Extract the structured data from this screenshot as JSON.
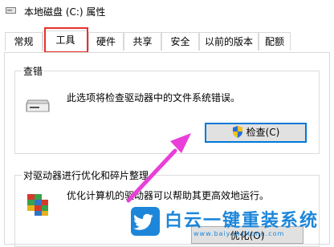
{
  "window": {
    "title": "本地磁盘 (C:) 属性"
  },
  "tabs": [
    {
      "label": "常规"
    },
    {
      "label": "工具"
    },
    {
      "label": "硬件"
    },
    {
      "label": "共享"
    },
    {
      "label": "安全"
    },
    {
      "label": "以前的版本"
    },
    {
      "label": "配额"
    }
  ],
  "active_tab": "工具",
  "error_check": {
    "group_title": "查错",
    "description": "此选项将检查驱动器中的文件系统错误。",
    "button_label": "检查(C)"
  },
  "optimize": {
    "group_title": "对驱动器进行优化和碎片整理",
    "description": "优化计算机的驱动器可以帮助其更高效地运行。",
    "button_label": "优化(O)"
  },
  "watermark": {
    "text": "白云一键重装系统",
    "url": "www.baiyunxitong.com"
  },
  "colors": {
    "highlight_box": "#e8312b",
    "arrow": "#e93fd8",
    "accent_button_border": "#0078d7",
    "watermark": "#1d86d9"
  },
  "icons": {
    "title": "drive-icon",
    "error_check": "drive-icon",
    "check_button": "shield-icon",
    "optimize": "defrag-icon",
    "watermark": "twitter-bird-icon"
  }
}
